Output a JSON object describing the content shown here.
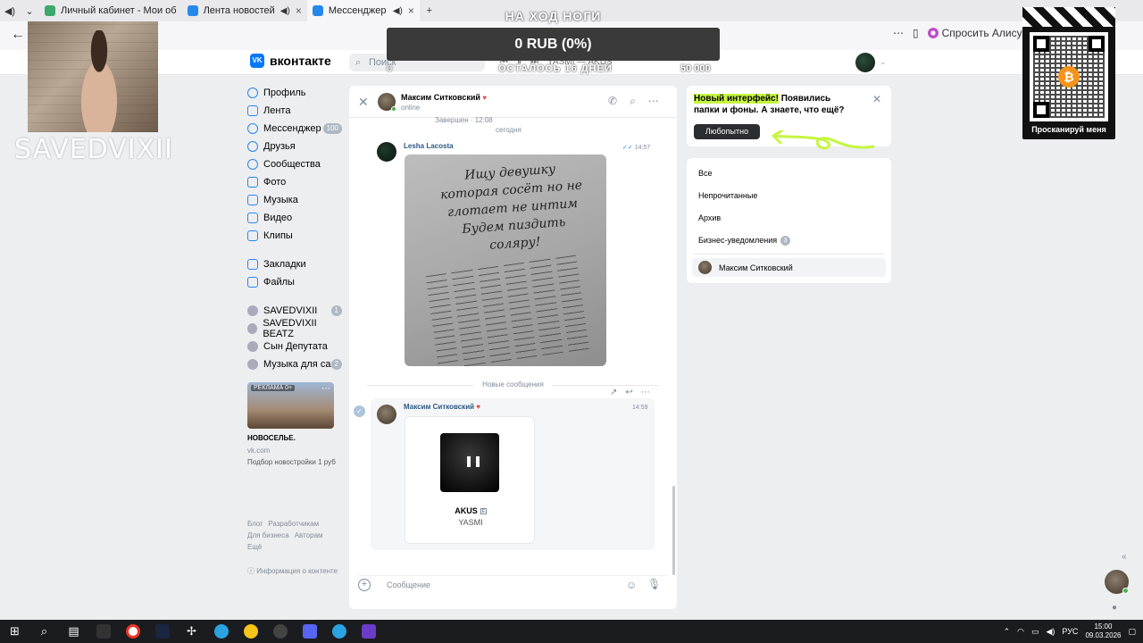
{
  "browser": {
    "tabs": [
      {
        "label": "Личный кабинет - Мои об",
        "color": "#3ca86b"
      },
      {
        "label": "Лента новостей",
        "color": "#2688eb"
      },
      {
        "label": "Мессенджер",
        "color": "#2688eb"
      }
    ],
    "new_tab": "+",
    "alice_label": "Спросить Алису А"
  },
  "stream": {
    "streamer_name": "SAVEDVIXII",
    "goal": {
      "title": "НА ХОД НОГИ",
      "progress_text": "0 RUB (0%)",
      "progress_fraction": 0,
      "min": "0",
      "remaining": "ОСТАЛОСЬ 16 ДНЕЙ",
      "max": "50 000"
    },
    "qr_label": "Просканируй меня"
  },
  "vk": {
    "logo_text": "вконтакте",
    "search_placeholder": "Поиск",
    "player_track": "YASMI — AKUS",
    "nav": [
      {
        "label": "Профиль",
        "icon": "profile-icon"
      },
      {
        "label": "Лента",
        "icon": "feed-icon"
      },
      {
        "label": "Мессенджер",
        "icon": "messenger-icon",
        "count": "100"
      },
      {
        "label": "Друзья",
        "icon": "friends-icon"
      },
      {
        "label": "Сообщества",
        "icon": "communities-icon"
      },
      {
        "label": "Фото",
        "icon": "photo-icon"
      },
      {
        "label": "Музыка",
        "icon": "music-icon"
      },
      {
        "label": "Видео",
        "icon": "video-icon"
      },
      {
        "label": "Клипы",
        "icon": "clips-icon"
      }
    ],
    "nav2": [
      {
        "label": "Закладки",
        "icon": "bookmarks-icon"
      },
      {
        "label": "Файлы",
        "icon": "files-icon"
      }
    ],
    "groups": [
      {
        "label": "SAVEDVIXII",
        "count": "1"
      },
      {
        "label": "SAVEDVIXII BEATZ"
      },
      {
        "label": "Сын Депутата"
      },
      {
        "label": "Музыка для са...",
        "count": "2"
      }
    ],
    "ad": {
      "badge": "РЕКЛАМА 0+",
      "title": "НОВОСЕЛЬЕ.",
      "domain": "vk.com",
      "description": "Подбор новостройки 1 руб"
    },
    "footer": {
      "links": [
        "Блог",
        "Разработчикам",
        "Для бизнеса",
        "Авторам",
        "Ещё"
      ],
      "info": "Информация о контенте"
    }
  },
  "chat": {
    "name": "Максим Ситковский",
    "status": "online",
    "prev_message": "Завершен · 12:08",
    "day_separator": "сегодня",
    "message1": {
      "author": "Lesha Lacosta",
      "time": "14:57",
      "photo_note": "Ищу девушку которая сосёт но не глотает не интим Будем пиздить соляру!"
    },
    "new_separator": "Новые сообщения",
    "message2": {
      "author": "Максим Ситковский",
      "time": "14:59",
      "track_title": "AKUS",
      "track_artist": "YASMI"
    },
    "composer_placeholder": "Сообщение"
  },
  "promo": {
    "highlight": "Новый интерфейс!",
    "text": " Появились папки и фоны. А знаете, что ещё?",
    "button": "Любопытно"
  },
  "filters": {
    "items": [
      "Все",
      "Непрочитанные",
      "Архив",
      "Бизнес-уведомления"
    ],
    "business_count": "3",
    "contact": "Максим Ситковский"
  },
  "taskbar": {
    "lang": "РУС",
    "time": "15:00",
    "date": "09.03.2026"
  },
  "colors": {
    "vk_blue": "#0077ff",
    "link": "#2a5885",
    "accent_green": "#c6f542"
  }
}
